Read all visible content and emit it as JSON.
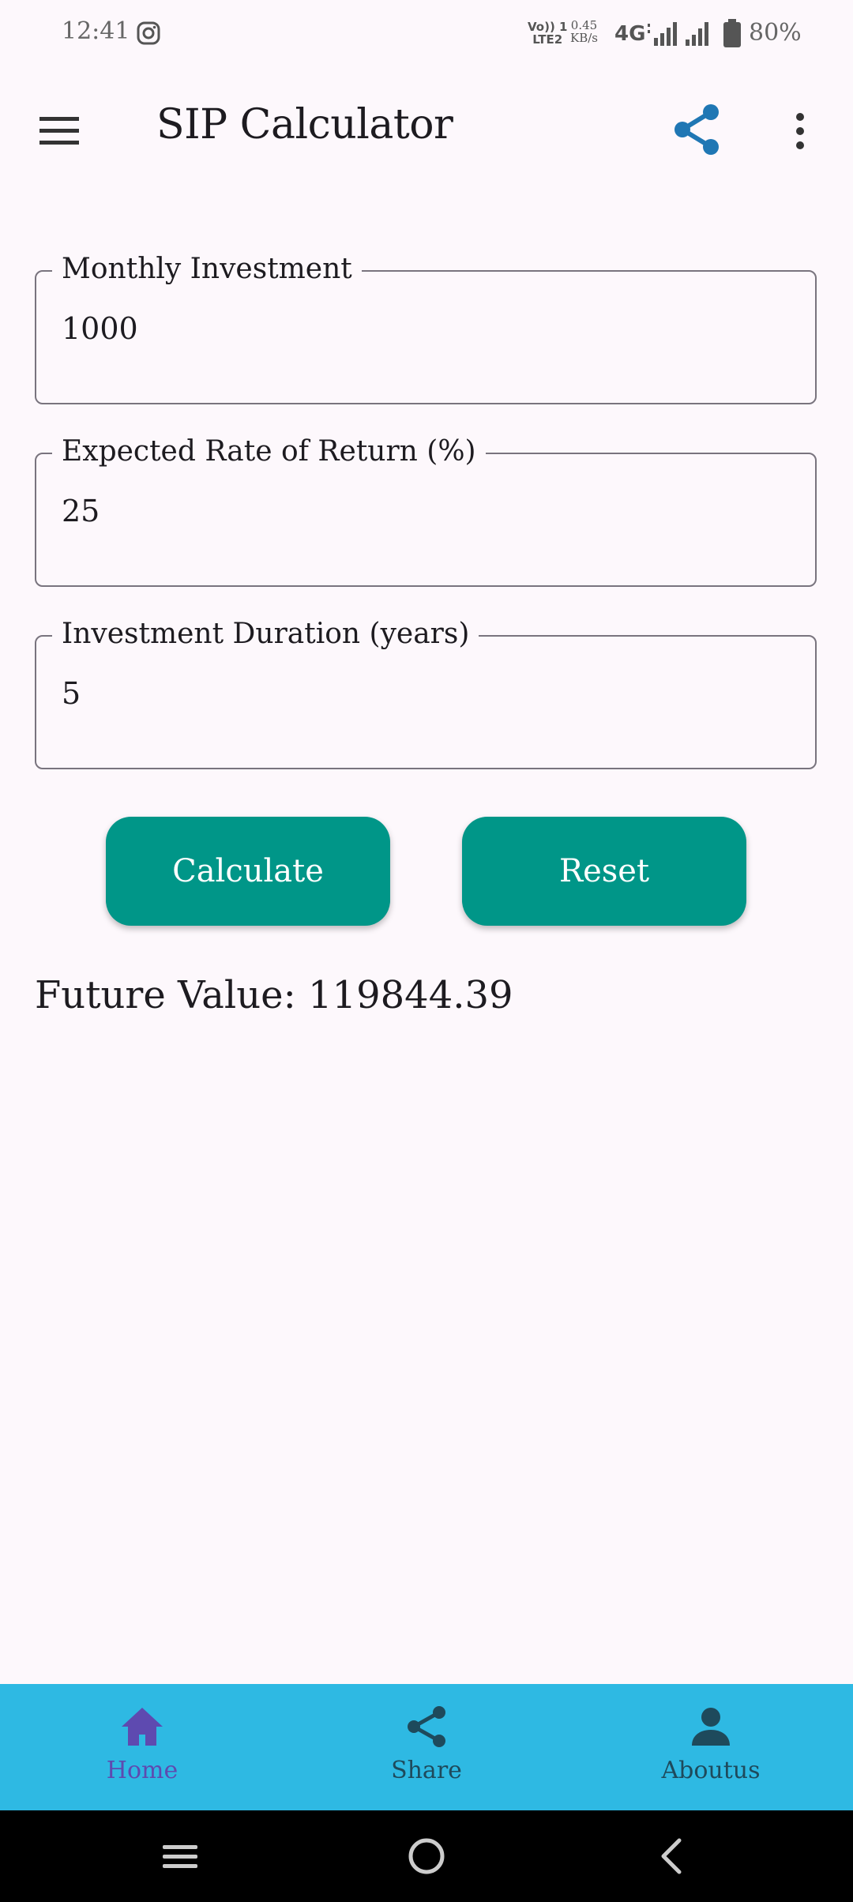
{
  "status_bar": {
    "time": "12:41",
    "network_top": "Vo)) 1",
    "network_bottom": "LTE2",
    "speed_value": "0.45",
    "speed_unit": "KB/s",
    "network_type": "4G",
    "battery": "80%",
    "icons": [
      "instagram-icon",
      "signal-icon",
      "battery-icon"
    ]
  },
  "app_bar": {
    "title": "SIP Calculator",
    "icons": [
      "menu-icon",
      "share-icon",
      "more-vert-icon"
    ],
    "share_color": "#1f77b4"
  },
  "form": {
    "monthly_investment": {
      "label": "Monthly Investment",
      "value": "1000"
    },
    "rate_of_return": {
      "label": "Expected Rate of Return (%)",
      "value": "25"
    },
    "duration": {
      "label": "Investment Duration (years)",
      "value": "5"
    }
  },
  "buttons": {
    "calculate": "Calculate",
    "reset": "Reset",
    "color": "#009688"
  },
  "result": {
    "text": "Future Value: 119844.39"
  },
  "bottom_nav": {
    "background": "#2eb9e3",
    "items": [
      {
        "label": "Home",
        "icon": "home-icon",
        "selected": true,
        "color": "#5e4ab0"
      },
      {
        "label": "Share",
        "icon": "share-icon",
        "selected": false,
        "color": "#1e4a5c"
      },
      {
        "label": "Aboutus",
        "icon": "person-icon",
        "selected": false,
        "color": "#1e4a5c"
      }
    ]
  },
  "system_nav": {
    "icons": [
      "recents-icon",
      "home-circle-icon",
      "back-icon"
    ]
  }
}
